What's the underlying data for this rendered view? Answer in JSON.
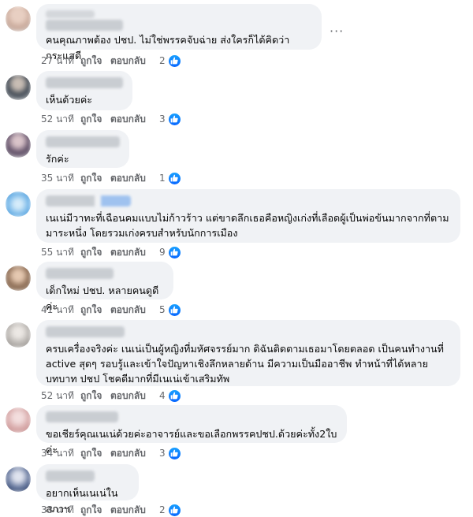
{
  "comments": [
    {
      "text": "คนคุณภาพต้อง ปชป. ไม่ใช่พรรคจับฉ่าย ส่งใครก็ได้คิดว่ากระแสดี",
      "time": "27 นาที",
      "like_label": "ถูกใจ",
      "reply_label": "ตอบกลับ",
      "likes": "2",
      "avatar_color": "#c9a99a"
    },
    {
      "text": "เห็นด้วยค่ะ",
      "time": "52 นาที",
      "like_label": "ถูกใจ",
      "reply_label": "ตอบกลับ",
      "likes": "3",
      "avatar_color": "#5a6470"
    },
    {
      "text": "รักค่ะ",
      "time": "35 นาที",
      "like_label": "ถูกใจ",
      "reply_label": "ตอบกลับ",
      "likes": "1",
      "avatar_color": "#7a6a78"
    },
    {
      "text": "เนเน่มีวาทะที่เฉือนคมแบบไม่ก้าวร้าว แต่ขาดลึกเธอคือหญิงเก่งที่เลือดผู้เป็นพ่อข้นมากจากที่ตามมาระหนึ่ง โดยรวมเก่งครบสำหรับนักการเมือง",
      "time": "55 นาที",
      "like_label": "ถูกใจ",
      "reply_label": "ตอบกลับ",
      "likes": "9",
      "avatar_color": "#74b6e8"
    },
    {
      "text": "เด็กใหม่ ปชป. หลายคนดูดีค่ะ",
      "time": "41 นาที",
      "like_label": "ถูกใจ",
      "reply_label": "ตอบกลับ",
      "likes": "5",
      "avatar_color": "#a4866c"
    },
    {
      "text": "ครบเครื่องจริงค่ะ เนเน่เป็นผู้หญิงที่มหัศจรรย์มาก ดิฉันติดตามเธอมาโดยตลอด เป็นคนทำงานที่ active สุดๆ รอบรู้และเข้าใจปัญหาเชิงลึกหลายด้าน มีความเป็นมืออาชีพ ทำหน้าที่ได้หลายบทบาท ปชป โชคดีมากที่มีเนเน่เข้าเสริมทัพ",
      "time": "52 นาที",
      "like_label": "ถูกใจ",
      "reply_label": "ตอบกลับ",
      "likes": "4",
      "avatar_color": "#b4b0ac"
    },
    {
      "text": "ขอเชียร์คุณเนเน่ด้วยค่ะอาจารย์และขอเลือกพรรคปชป.ด้วยค่ะทั้ง2ใบค่ะ",
      "time": "34 นาที",
      "like_label": "ถูกใจ",
      "reply_label": "ตอบกลับ",
      "likes": "3",
      "avatar_color": "#d6a6a6"
    },
    {
      "text": "อยากเห็นเนเน่ในสภาฯ",
      "time": "33 นาที",
      "like_label": "ถูกใจ",
      "reply_label": "ตอบกลับ",
      "likes": "2",
      "avatar_color": "#5c6e96"
    }
  ],
  "more_label": "···"
}
